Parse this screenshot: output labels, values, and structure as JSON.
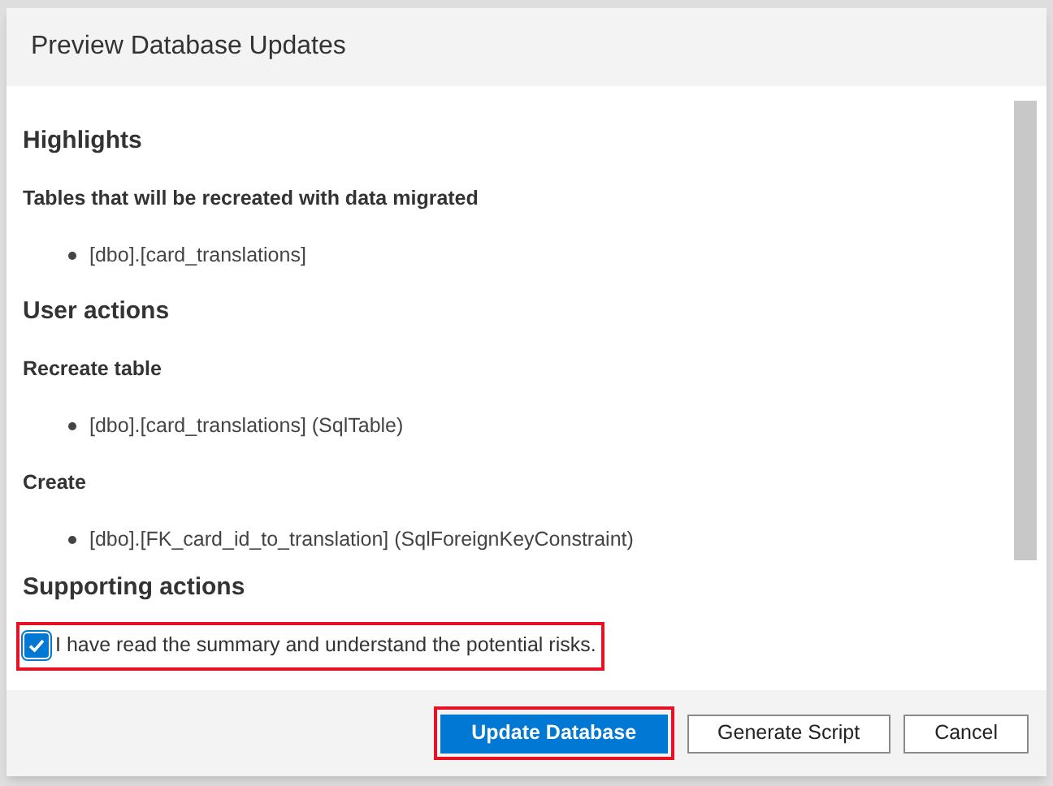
{
  "dialog": {
    "title": "Preview Database Updates"
  },
  "sections": [
    {
      "heading": "Highlights",
      "groups": [
        {
          "title": "Tables that will be recreated with data migrated",
          "items": [
            "[dbo].[card_translations]"
          ]
        }
      ]
    },
    {
      "heading": "User actions",
      "groups": [
        {
          "title": "Recreate table",
          "items": [
            "[dbo].[card_translations] (SqlTable)"
          ]
        },
        {
          "title": "Create",
          "items": [
            "[dbo].[FK_card_id_to_translation] (SqlForeignKeyConstraint)"
          ]
        }
      ]
    }
  ],
  "supporting": {
    "heading": "Supporting actions",
    "acknowledge": {
      "label": "I have read the summary and understand the potential risks.",
      "checked": true
    }
  },
  "buttons": [
    {
      "label": "Update Database",
      "kind": "primary"
    },
    {
      "label": "Generate Script",
      "kind": "default"
    },
    {
      "label": "Cancel",
      "kind": "default"
    }
  ]
}
